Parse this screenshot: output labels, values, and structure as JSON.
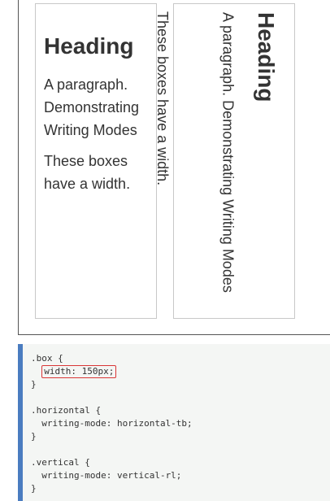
{
  "example": {
    "horizontal_box": {
      "heading": "Heading",
      "paragraph1": "A paragraph. Demonstrating Writing Modes",
      "paragraph2": "These boxes have a width."
    },
    "vertical_box": {
      "heading": "Heading",
      "paragraph1": "A paragraph. Demonstrating Writing Modes",
      "paragraph2": "These boxes have a width."
    }
  },
  "code": {
    "lines": [
      ".box {",
      "  width: 150px;",
      "}",
      "",
      ".horizontal {",
      "  writing-mode: horizontal-tb;",
      "}",
      "",
      ".vertical {",
      "  writing-mode: vertical-rl;",
      "}"
    ],
    "highlight_line": 1
  },
  "colors": {
    "accent_bar": "#4a7cc0",
    "highlight_border": "#d93636",
    "code_background": "#f4f6f4"
  }
}
